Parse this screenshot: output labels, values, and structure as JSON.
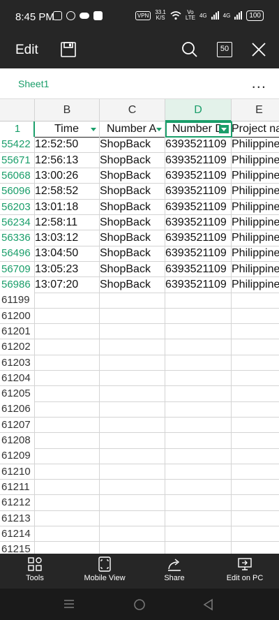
{
  "status_bar": {
    "time": "8:45 PM",
    "speed_value": "33.1",
    "speed_unit": "K/S",
    "vpn": "VPN",
    "volte_top": "Vo",
    "volte_bottom": "LTE",
    "net1": "4G",
    "net2": "4G",
    "battery": "100"
  },
  "toolbar": {
    "edit_label": "Edit",
    "page_count": "50"
  },
  "sheet_tabs": {
    "active_tab": "Sheet1",
    "more": "..."
  },
  "grid": {
    "corner_label": "",
    "columns": [
      "B",
      "C",
      "D",
      "E"
    ],
    "selected_column": "D",
    "header_row": {
      "row_number": "1",
      "cells": [
        "Time",
        "Number A",
        "Number D",
        "Project na"
      ]
    },
    "data_rows": [
      {
        "row": "55422",
        "cells": [
          "12:52:50",
          "ShopBack",
          "6393521109",
          "Philippines"
        ]
      },
      {
        "row": "55671",
        "cells": [
          "12:56:13",
          "ShopBack",
          "6393521109",
          "Philippines"
        ]
      },
      {
        "row": "56068",
        "cells": [
          "13:00:26",
          "ShopBack",
          "6393521109",
          "Philippines"
        ]
      },
      {
        "row": "56096",
        "cells": [
          "12:58:52",
          "ShopBack",
          "6393521109",
          "Philippines"
        ]
      },
      {
        "row": "56203",
        "cells": [
          "13:01:18",
          "ShopBack",
          "6393521109",
          "Philippines"
        ]
      },
      {
        "row": "56234",
        "cells": [
          "12:58:11",
          "ShopBack",
          "6393521109",
          "Philippines"
        ]
      },
      {
        "row": "56336",
        "cells": [
          "13:03:12",
          "ShopBack",
          "6393521109",
          "Philippines"
        ]
      },
      {
        "row": "56496",
        "cells": [
          "13:04:50",
          "ShopBack",
          "6393521109",
          "Philippines"
        ]
      },
      {
        "row": "56709",
        "cells": [
          "13:05:23",
          "ShopBack",
          "6393521109",
          "Philippines"
        ]
      },
      {
        "row": "56986",
        "cells": [
          "13:07:20",
          "ShopBack",
          "6393521109",
          "Philippines"
        ]
      }
    ],
    "empty_rows": [
      "61199",
      "61200",
      "61201",
      "61202",
      "61203",
      "61204",
      "61205",
      "61206",
      "61207",
      "61208",
      "61209",
      "61210",
      "61211",
      "61212",
      "61213",
      "61214",
      "61215"
    ]
  },
  "bottom_bar": {
    "tools": "Tools",
    "mobile_view": "Mobile View",
    "share": "Share",
    "edit_on_pc": "Edit on PC"
  },
  "colors": {
    "accent": "#1a9e6a",
    "toolbar_bg": "#262626",
    "nav_bg": "#1a1a1a"
  }
}
